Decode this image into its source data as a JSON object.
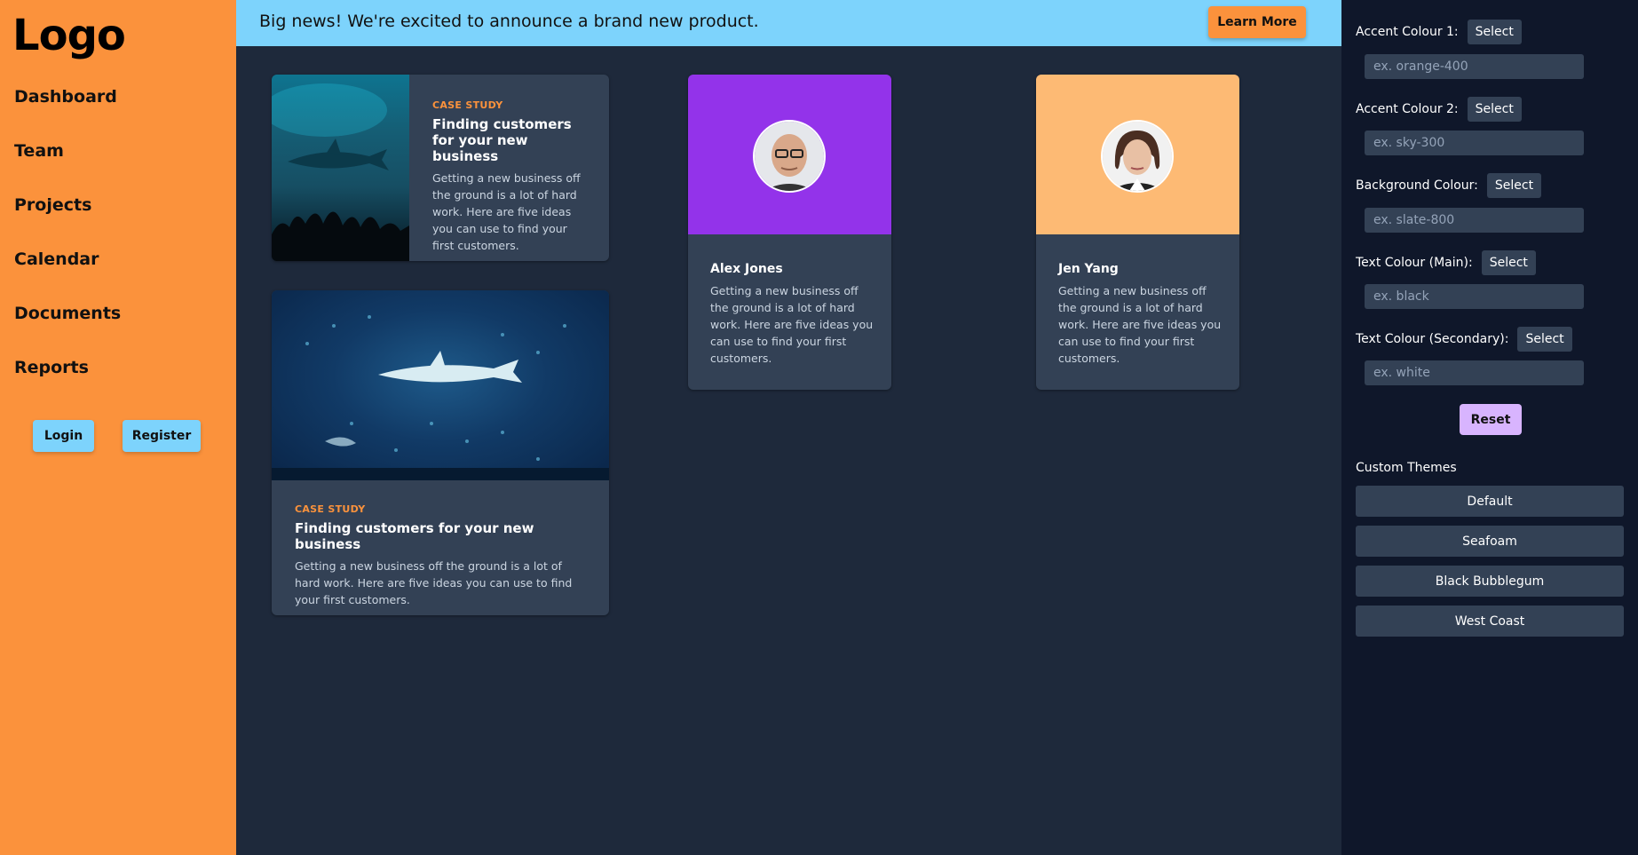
{
  "sidebar": {
    "logo": "Logo",
    "nav": [
      "Dashboard",
      "Team",
      "Projects",
      "Calendar",
      "Documents",
      "Reports"
    ],
    "login_label": "Login",
    "register_label": "Register"
  },
  "banner": {
    "text": "Big news! We're excited to announce a brand new product.",
    "button_label": "Learn More"
  },
  "cards": {
    "case_study_1": {
      "eyebrow": "CASE STUDY",
      "title": "Finding customers for your new business",
      "body": "Getting a new business off the ground is a lot of hard work. Here are five ideas you can use to find your first customers."
    },
    "case_study_2": {
      "eyebrow": "CASE STUDY",
      "title": "Finding customers for your new business",
      "body": "Getting a new business off the ground is a lot of hard work. Here are five ideas you can use to find your first customers."
    },
    "profile_1": {
      "name": "Alex Jones",
      "body": "Getting a new business off the ground is a lot of hard work. Here are five ideas you can use to find your first customers.",
      "color": "#9333ea"
    },
    "profile_2": {
      "name": "Jen Yang",
      "body": "Getting a new business off the ground is a lot of hard work. Here are five ideas you can use to find your first customers.",
      "color": "#fdba74"
    }
  },
  "panel": {
    "select_label": "Select",
    "fields": [
      {
        "label": "Accent Colour 1:",
        "placeholder": "ex. orange-400"
      },
      {
        "label": "Accent Colour 2:",
        "placeholder": "ex. sky-300"
      },
      {
        "label": "Background Colour:",
        "placeholder": "ex. slate-800"
      },
      {
        "label": "Text Colour (Main):",
        "placeholder": "ex. black"
      },
      {
        "label": "Text Colour (Secondary):",
        "placeholder": "ex. white"
      }
    ],
    "reset_label": "Reset",
    "themes_title": "Custom Themes",
    "themes": [
      "Default",
      "Seafoam",
      "Black Bubblegum",
      "West Coast"
    ]
  },
  "colors": {
    "accent_1": "#fb923c",
    "accent_2": "#7dd3fc",
    "background": "#1e293b",
    "panel": "#0f172a",
    "card": "#334155",
    "reset": "#d8b4fe"
  }
}
